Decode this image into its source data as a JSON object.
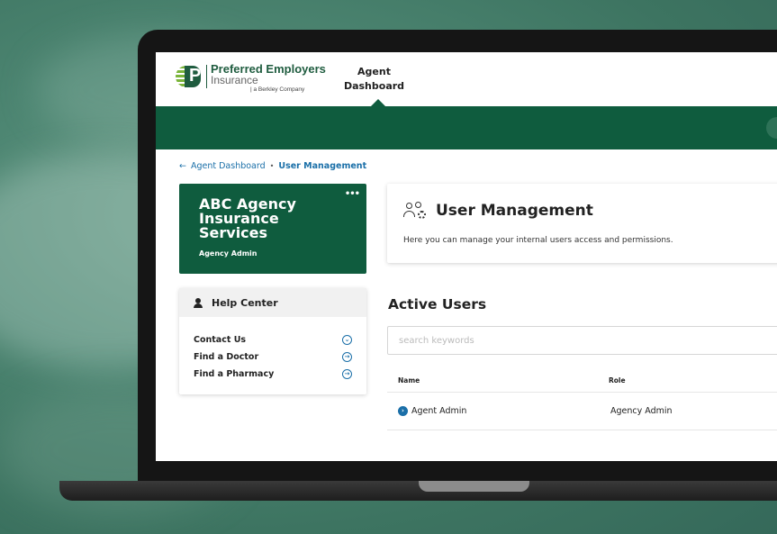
{
  "logo": {
    "name": "Preferred Employers",
    "sub": "Insurance",
    "tagline": "| a Berkley Company"
  },
  "nav": {
    "tab_line1": "Agent",
    "tab_line2": "Dashboard"
  },
  "breadcrumb": {
    "back": "Agent Dashboard",
    "separator": "•",
    "current": "User Management"
  },
  "agency": {
    "name": "ABC Agency Insurance Services",
    "role": "Agency Admin",
    "menu_icon": "more-icon"
  },
  "help_center": {
    "title": "Help Center",
    "items": [
      {
        "label": "Contact Us",
        "icon": "chevron-down-circle-icon"
      },
      {
        "label": "Find a Doctor",
        "icon": "arrow-right-circle-icon"
      },
      {
        "label": "Find a Pharmacy",
        "icon": "arrow-right-circle-icon"
      }
    ]
  },
  "user_management": {
    "title": "User Management",
    "description": "Here you can manage your internal users access and permissions."
  },
  "active_users": {
    "title": "Active Users",
    "search_placeholder": "search keywords",
    "columns": {
      "name": "Name",
      "role": "Role"
    },
    "rows": [
      {
        "name": "Agent Admin",
        "role": "Agency Admin"
      }
    ]
  },
  "colors": {
    "brand_green": "#0f5c3e",
    "link_blue": "#1a6fa8"
  }
}
